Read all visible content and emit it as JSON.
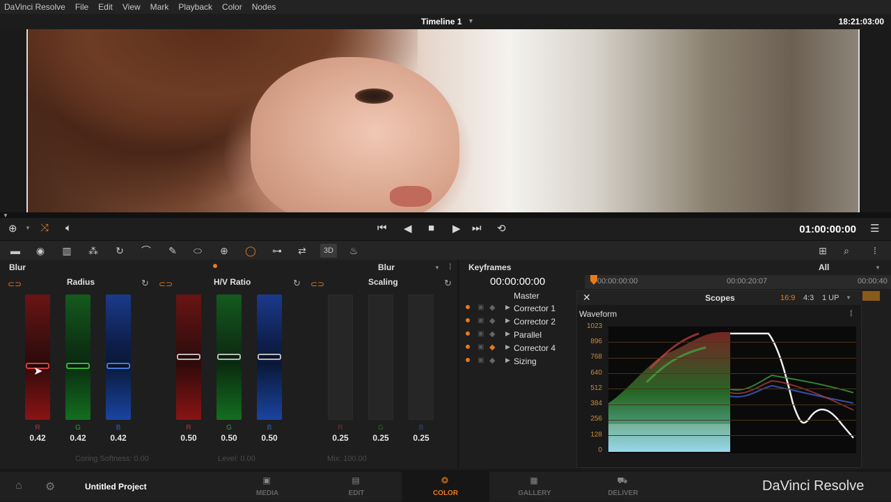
{
  "menu": [
    "DaVinci Resolve",
    "File",
    "Edit",
    "View",
    "Mark",
    "Playback",
    "Color",
    "Nodes"
  ],
  "viewer": {
    "timeline_name": "Timeline 1",
    "timecode_top": "18:21:03:00",
    "timecode_main": "01:00:00:00"
  },
  "blur_panel": {
    "title": "Blur",
    "mode": "Blur",
    "groups": [
      {
        "name": "Radius",
        "channels": [
          {
            "ch": "R",
            "value": "0.42"
          },
          {
            "ch": "G",
            "value": "0.42"
          },
          {
            "ch": "B",
            "value": "0.42"
          }
        ]
      },
      {
        "name": "H/V Ratio",
        "channels": [
          {
            "ch": "R",
            "value": "0.50"
          },
          {
            "ch": "G",
            "value": "0.50"
          },
          {
            "ch": "B",
            "value": "0.50"
          }
        ]
      },
      {
        "name": "Scaling",
        "channels": [
          {
            "ch": "R",
            "value": "0.25"
          },
          {
            "ch": "G",
            "value": "0.25"
          },
          {
            "ch": "B",
            "value": "0.25"
          }
        ]
      }
    ],
    "footer": {
      "coring": "Coring Softness: 0.00",
      "level": "Level: 0.00",
      "mix": "Mix: 100.00"
    }
  },
  "keyframes": {
    "title": "Keyframes",
    "filter": "All",
    "timecode": "00:00:00:00",
    "ruler": [
      "00:00:00:00",
      "00:00:20:07",
      "00:00:40"
    ],
    "tracks": [
      "Master",
      "Corrector 1",
      "Corrector 2",
      "Parallel",
      "Corrector 4",
      "Sizing"
    ]
  },
  "scopes": {
    "title": "Scopes",
    "ratio_a": "16:9",
    "ratio_b": "4:3",
    "layout": "1 UP",
    "waveform_title": "Waveform",
    "axis": [
      "1023",
      "896",
      "768",
      "640",
      "512",
      "384",
      "256",
      "128",
      "0"
    ]
  },
  "nav": {
    "project": "Untitled Project",
    "items": [
      "MEDIA",
      "EDIT",
      "COLOR",
      "GALLERY",
      "DELIVER"
    ],
    "active": "COLOR",
    "brand": "DaVinci Resolve"
  },
  "colors": {
    "accent": "#e87a1a"
  }
}
